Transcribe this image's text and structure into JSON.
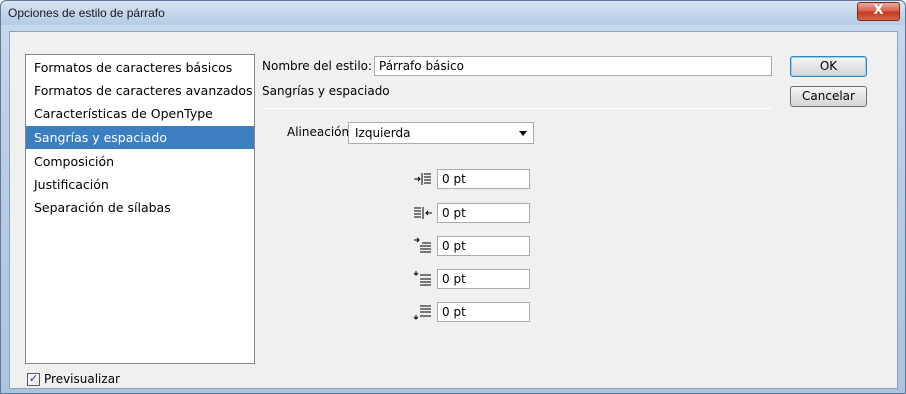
{
  "window": {
    "title": "Opciones de estilo de párrafo",
    "close_label": "X"
  },
  "sidebar": {
    "items": [
      {
        "label": "Formatos de caracteres básicos",
        "selected": false
      },
      {
        "label": "Formatos de caracteres avanzados",
        "selected": false
      },
      {
        "label": "Características de OpenType",
        "selected": false
      },
      {
        "label": "Sangrías y espaciado",
        "selected": true
      },
      {
        "label": "Composición",
        "selected": false
      },
      {
        "label": "Justificación",
        "selected": false
      },
      {
        "label": "Separación de sílabas",
        "selected": false
      }
    ]
  },
  "preview": {
    "label": "Previsualizar",
    "checked": true
  },
  "style_name": {
    "label": "Nombre del estilo:",
    "value": "Párrafo básico"
  },
  "section": {
    "title": "Sangrías y espaciado"
  },
  "alignment": {
    "label": "Alineación:",
    "value": "Izquierda"
  },
  "fields": [
    {
      "icon": "left-indent-icon",
      "value": "0 pt"
    },
    {
      "icon": "right-indent-icon",
      "value": "0 pt"
    },
    {
      "icon": "first-line-indent-icon",
      "value": "0 pt"
    },
    {
      "icon": "space-before-icon",
      "value": "0 pt"
    },
    {
      "icon": "space-after-icon",
      "value": "0 pt"
    }
  ],
  "buttons": {
    "ok": "OK",
    "cancel": "Cancelar"
  },
  "colors": {
    "selection": "#3c7fc1",
    "close_button": "#c43a1e"
  }
}
